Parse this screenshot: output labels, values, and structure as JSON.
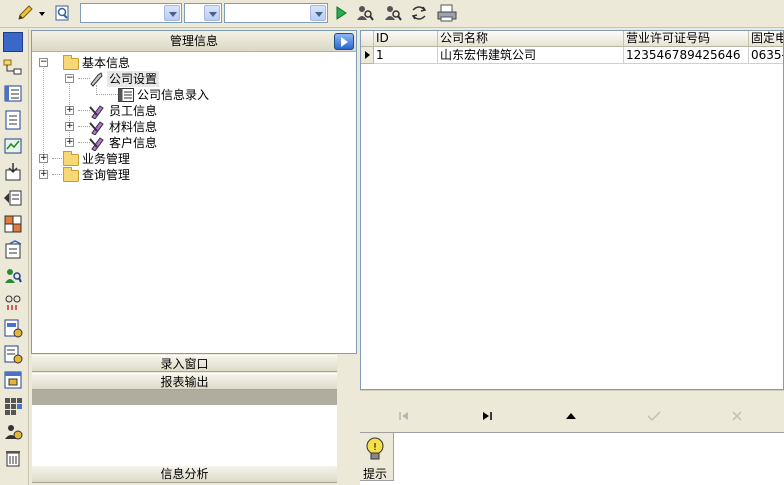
{
  "toolbar": {
    "combo1_value": "",
    "combo2_value": "",
    "combo3_value": ""
  },
  "tree": {
    "header": "管理信息",
    "nodes": [
      {
        "label": "基本信息"
      },
      {
        "label": "公司设置"
      },
      {
        "label": "公司信息录入"
      },
      {
        "label": "员工信息"
      },
      {
        "label": "材料信息"
      },
      {
        "label": "客户信息"
      },
      {
        "label": "业务管理"
      },
      {
        "label": "查询管理"
      }
    ]
  },
  "sections": {
    "entry_window": "录入窗口",
    "report_output": "报表输出",
    "info_analysis": "信息分析"
  },
  "grid": {
    "columns": [
      "ID",
      "公司名称",
      "营业许可证号码",
      "固定电"
    ],
    "rows": [
      [
        "1",
        "山东宏伟建筑公司",
        "123546789425646",
        "0635-"
      ]
    ]
  },
  "hint": {
    "label": "提示"
  },
  "colors": {
    "background": "#ece9d8",
    "border_blue": "#7f9db9",
    "folder_yellow": "#f8d775"
  }
}
